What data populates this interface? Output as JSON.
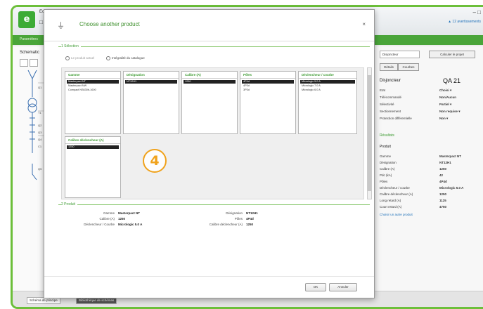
{
  "app": {
    "title_short": "Ecodial",
    "quick_access": "□ ▾",
    "window_controls": "– □",
    "status_right": "▲ 12 avertissements",
    "ribbon_tab": "Paramètres"
  },
  "left_panel": {
    "title": "Schematic",
    "schematic_labels": [
      "Q1",
      "T1",
      "Q2",
      "Q3",
      "Q4",
      "C1",
      "Q5"
    ]
  },
  "right_panel": {
    "dropdown_value": "Disjoncteur",
    "calc_button": "Calculer le projet",
    "tab_details": "Détails",
    "tab_courses": "Courbes",
    "device_title": "Disjoncteur",
    "device_id": "QA 21",
    "properties": [
      {
        "label": "Etat",
        "value": "Choisi ▾"
      },
      {
        "label": "Télécommandé",
        "value": "Non/Aucun"
      },
      {
        "label": "Sélectivité",
        "value": "Partiel ▾"
      },
      {
        "label": "Sectionnement",
        "value": "Non requise ▾"
      },
      {
        "label": "Protection différentielle",
        "value": "Non ▾"
      }
    ],
    "results_section": "Résultats",
    "product_section": "Produit",
    "product_props": [
      {
        "label": "Gamme",
        "value": "Masterpact NT"
      },
      {
        "label": "Désignation",
        "value": "NT12H1"
      },
      {
        "label": "Calibre (A)",
        "value": "1250"
      },
      {
        "label": "Pdc (kA)",
        "value": "42"
      },
      {
        "label": "Pôles",
        "value": "4P4d"
      },
      {
        "label": "Déclencheur / courbe",
        "value": "Micrologic 5.0 A"
      },
      {
        "label": "Calibre déclencheur (A)",
        "value": "1250"
      },
      {
        "label": "Long retard (A)",
        "value": "1125"
      },
      {
        "label": "Court retard (A)",
        "value": "4750"
      }
    ],
    "link": "Choisir un autre produit"
  },
  "bottom": {
    "tabs": [
      "Schéma de principe",
      "Bibliothèque de schémas"
    ]
  },
  "dialog": {
    "title": "Choose another product",
    "close": "×",
    "section_selection": "1 Sélection",
    "option_current": "Le produit actuel",
    "option_catalogue": "Intégralité du catalogue",
    "columns": [
      {
        "header": "Gamme",
        "items": [
          "Masterpact NT",
          "Masterpact NW",
          "Compact NS630b-1600"
        ],
        "selected": 0
      },
      {
        "header": "Désignation",
        "items": [
          "NT12H1"
        ],
        "selected": 0
      },
      {
        "header": "Calibre (A)",
        "items": [
          "1250"
        ],
        "selected": 0
      },
      {
        "header": "Pôles",
        "items": [
          "4P4d",
          "4P3d",
          "3P3d"
        ],
        "selected": 0
      },
      {
        "header": "Déclencheur / courbe",
        "items": [
          "Micrologic 5.0 A",
          "Micrologic 7.0 A",
          "Micrologic 6.0 A"
        ],
        "selected": 0
      },
      {
        "header": "Calibre déclencheur (A)",
        "items": [
          "1250"
        ],
        "selected": 0
      }
    ],
    "badge": "4",
    "section_product": "2 Produit",
    "product_left": [
      {
        "label": "Gamme",
        "value": "Masterpact NT"
      },
      {
        "label": "Calibre (A)",
        "value": "1250"
      },
      {
        "label": "Déclencheur / Courbe",
        "value": "Micrologic 5.0 A"
      }
    ],
    "product_right": [
      {
        "label": "Désignation",
        "value": "NT12H1"
      },
      {
        "label": "Pôles",
        "value": "4P4d"
      },
      {
        "label": "Calibre déclencheur (A)",
        "value": "1250"
      }
    ],
    "ok": "OK",
    "cancel": "Annuler"
  }
}
